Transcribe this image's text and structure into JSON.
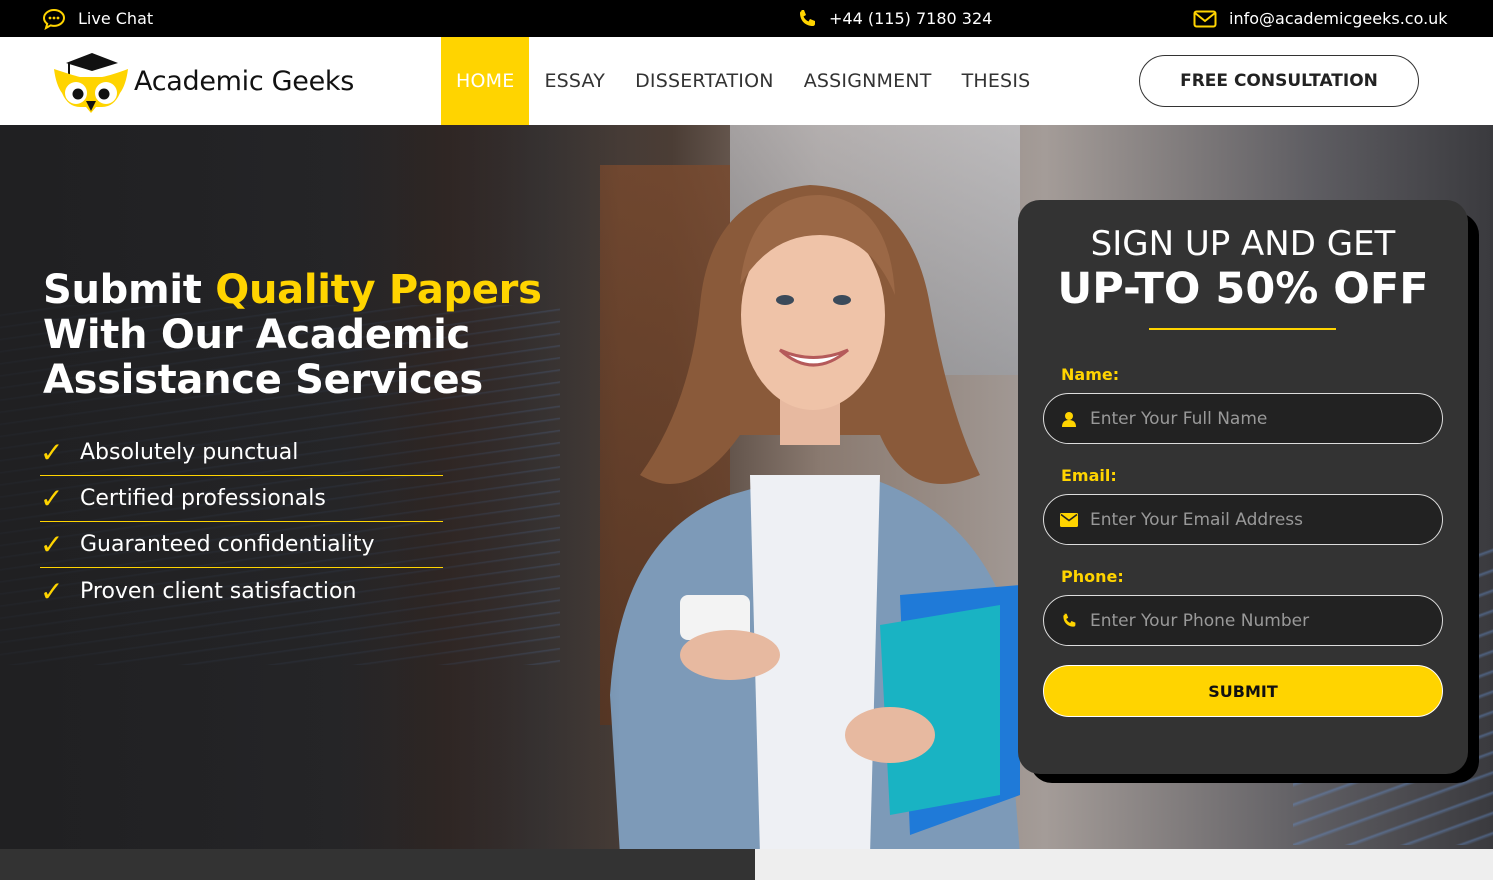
{
  "topbar": {
    "live_chat": "Live Chat",
    "phone": "+44 (115) 7180 324",
    "email": "info@academicgeeks.co.uk",
    "icons": [
      "chat-bubble-icon",
      "phone-icon",
      "envelope-icon"
    ]
  },
  "header": {
    "logo_text": "Academic Geeks",
    "nav": [
      {
        "label": "HOME",
        "active": true
      },
      {
        "label": "ESSAY",
        "active": false
      },
      {
        "label": "DISSERTATION",
        "active": false
      },
      {
        "label": "ASSIGNMENT",
        "active": false
      },
      {
        "label": "THESIS",
        "active": false
      }
    ],
    "cta": "FREE CONSULTATION"
  },
  "hero": {
    "headline_pre": "Submit ",
    "headline_highlight": "Quality Papers",
    "headline_line2": "With Our Academic",
    "headline_line3": "Assistance Services",
    "features": [
      "Absolutely punctual",
      "Certified professionals",
      "Guaranteed confidentiality",
      "Proven client satisfaction"
    ],
    "check_glyph": "✓"
  },
  "signup": {
    "title_line1": "SIGN UP AND GET",
    "title_line2": "UP-TO 50% OFF",
    "name_label": "Name:",
    "name_placeholder": "Enter Your Full Name",
    "email_label": "Email:",
    "email_placeholder": "Enter Your Email Address",
    "phone_label": "Phone:",
    "phone_placeholder": "Enter Your Phone Number",
    "submit": "SUBMIT"
  },
  "colors": {
    "accent": "#ffd400",
    "topbar": "#000000",
    "card": "#333333",
    "input_bg": "#222222"
  }
}
